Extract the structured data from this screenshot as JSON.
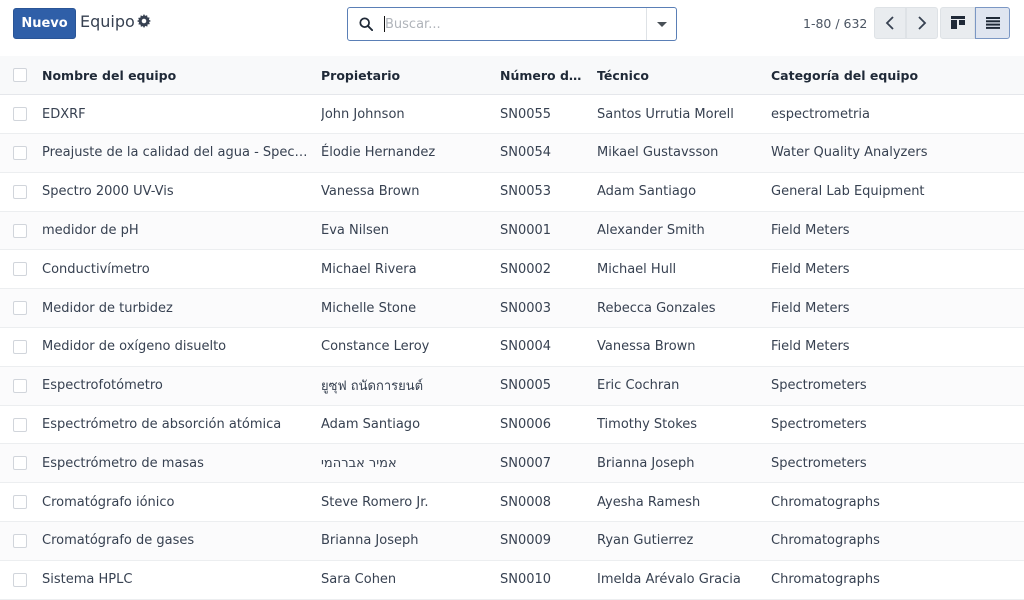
{
  "control_panel": {
    "new_button": "Nuevo",
    "title": "Equipo",
    "gear_icon": "gear-icon",
    "search": {
      "placeholder": "Buscar...",
      "value": ""
    },
    "pager": {
      "value": "1-80 / 632"
    },
    "icons": {
      "search": "magnifier-icon",
      "prev": "chevron-left-icon",
      "next": "chevron-right-icon",
      "kanban": "kanban-view-icon",
      "list": "list-view-icon"
    }
  },
  "table": {
    "columns": [
      "Nombre del equipo",
      "Propietario",
      "Número de …",
      "Técnico",
      "Categoría del equipo"
    ],
    "rows": [
      {
        "name": "EDXRF",
        "owner": "John Johnson",
        "serial": "SN0055",
        "technician": "Santos Urrutia Morell",
        "category": "espectrometria"
      },
      {
        "name": "Preajuste de la calidad del agua - Spectro…",
        "owner": "Élodie Hernandez",
        "serial": "SN0054",
        "technician": "Mikael Gustavsson",
        "category": "Water Quality Analyzers"
      },
      {
        "name": "Spectro 2000 UV-Vis",
        "owner": "Vanessa Brown",
        "serial": "SN0053",
        "technician": "Adam Santiago",
        "category": "General Lab Equipment"
      },
      {
        "name": "medidor de pH",
        "owner": "Eva Nilsen",
        "serial": "SN0001",
        "technician": "Alexander Smith",
        "category": "Field Meters"
      },
      {
        "name": "Conductivímetro",
        "owner": "Michael Rivera",
        "serial": "SN0002",
        "technician": "Michael Hull",
        "category": "Field Meters"
      },
      {
        "name": "Medidor de turbidez",
        "owner": "Michelle Stone",
        "serial": "SN0003",
        "technician": "Rebecca Gonzales",
        "category": "Field Meters"
      },
      {
        "name": "Medidor de oxígeno disuelto",
        "owner": "Constance Leroy",
        "serial": "SN0004",
        "technician": "Vanessa Brown",
        "category": "Field Meters"
      },
      {
        "name": "Espectrofotómetro",
        "owner": "ยูซุฟ ถนัดการยนต์",
        "serial": "SN0005",
        "technician": "Eric Cochran",
        "category": "Spectrometers"
      },
      {
        "name": "Espectrómetro de absorción atómica",
        "owner": "Adam Santiago",
        "serial": "SN0006",
        "technician": "Timothy Stokes",
        "category": "Spectrometers"
      },
      {
        "name": "Espectrómetro de masas",
        "owner": "אמיר אברהמי",
        "serial": "SN0007",
        "technician": "Brianna Joseph",
        "category": "Spectrometers"
      },
      {
        "name": "Cromatógrafo iónico",
        "owner": "Steve Romero Jr.",
        "serial": "SN0008",
        "technician": "Ayesha Ramesh",
        "category": "Chromatographs"
      },
      {
        "name": "Cromatógrafo de gases",
        "owner": "Brianna Joseph",
        "serial": "SN0009",
        "technician": "Ryan Gutierrez",
        "category": "Chromatographs"
      },
      {
        "name": "Sistema HPLC",
        "owner": "Sara Cohen",
        "serial": "SN0010",
        "technician": "Imelda Arévalo Gracia",
        "category": "Chromatographs"
      }
    ]
  }
}
